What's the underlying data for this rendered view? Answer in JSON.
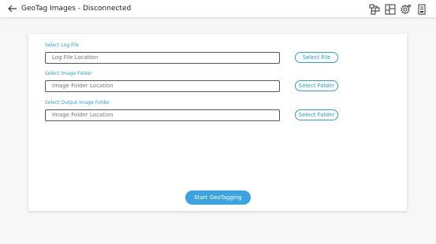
{
  "header": {
    "title": "GeoTag Images - Disconnected",
    "icons": [
      "back-arrow-icon",
      "network-icon",
      "layout-icon",
      "settings-icon",
      "report-icon"
    ]
  },
  "form": {
    "log_file": {
      "label": "Select Log File",
      "placeholder": "Log File Location",
      "button": "Select File"
    },
    "image_folder": {
      "label": "Select Image Folder",
      "placeholder": "Image Folder Location",
      "button": "Select Folder"
    },
    "output_folder": {
      "label": "Select Output Image Folder",
      "placeholder": "Image Folder Location",
      "button": "Select Folder"
    },
    "start_button": "Start GeoTagging"
  },
  "colors": {
    "accent": "#2a9fd6",
    "start_button_bg": "#3aa3e0",
    "page_bg": "#f7f7f7",
    "card_bg": "#ffffff"
  }
}
